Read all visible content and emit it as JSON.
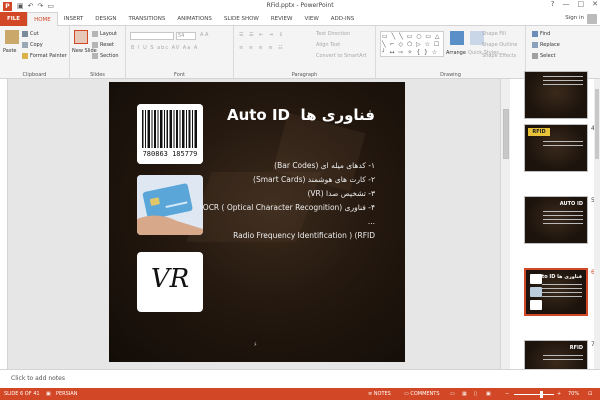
{
  "window": {
    "app_icon": "P",
    "title": "RFid.pptx - PowerPoint",
    "controls": [
      "?",
      "—",
      "□",
      "✕"
    ],
    "qat": [
      "save-icon",
      "undo-icon",
      "redo-icon",
      "start-slideshow-icon"
    ]
  },
  "tabs": [
    {
      "label": "FILE"
    },
    {
      "label": "HOME"
    },
    {
      "label": "INSERT"
    },
    {
      "label": "DESIGN"
    },
    {
      "label": "TRANSITIONS"
    },
    {
      "label": "ANIMATIONS"
    },
    {
      "label": "SLIDE SHOW"
    },
    {
      "label": "REVIEW"
    },
    {
      "label": "VIEW"
    },
    {
      "label": "ADD-INS"
    }
  ],
  "account": {
    "signin": "Sign in"
  },
  "ribbon": {
    "clipboard": {
      "label": "Clipboard",
      "paste": "Paste",
      "cut": "Cut",
      "copy": "Copy",
      "format_painter": "Format Painter"
    },
    "slides": {
      "label": "Slides",
      "new_slide": "New Slide",
      "layout": "Layout",
      "reset": "Reset",
      "section": "Section"
    },
    "font": {
      "label": "Font",
      "size": "54",
      "buttons": "B I U S abc AV Aa A"
    },
    "paragraph": {
      "label": "Paragraph",
      "text_direction": "Text Direction",
      "align_text": "Align Text",
      "convert_smartart": "Convert to SmartArt"
    },
    "drawing": {
      "label": "Drawing",
      "arrange": "Arrange",
      "quick_styles": "Quick Styles",
      "shape_fill": "Shape Fill",
      "shape_outline": "Shape Outline",
      "shape_effects": "Shape Effects"
    },
    "editing": {
      "label": "Editing",
      "find": "Find",
      "replace": "Replace",
      "select": "Select"
    }
  },
  "slide": {
    "title_part1": "فناوری ها",
    "title_part2": "Auto ID",
    "bullets": [
      "۱- کدهای میله ای (Bar Codes)",
      "۲- کارت های هوشمند (Smart Cards)",
      "۳- تشخیص صدا (VR)",
      "۴- فناوری OCR ( Optical Character Recognition)",
      "...",
      "Radio Frequency Identification ) (RFID"
    ],
    "barcode_number": "780863 185779",
    "vr_logo": "VR",
    "page_number": "۶"
  },
  "thumbnails": [
    {
      "num": "4",
      "title": "RFID"
    },
    {
      "num": "5",
      "title": "AUTO ID"
    },
    {
      "num": "6",
      "title": "فناوری ها Auto ID"
    },
    {
      "num": "7",
      "title": "RFID"
    }
  ],
  "notes": {
    "placeholder": "Click to add notes"
  },
  "status": {
    "slide_of": "SLIDE 6 OF 41",
    "language": "PERSIAN",
    "notes": "NOTES",
    "comments": "COMMENTS",
    "zoom": "70%"
  },
  "colors": {
    "accent": "#d24726"
  }
}
